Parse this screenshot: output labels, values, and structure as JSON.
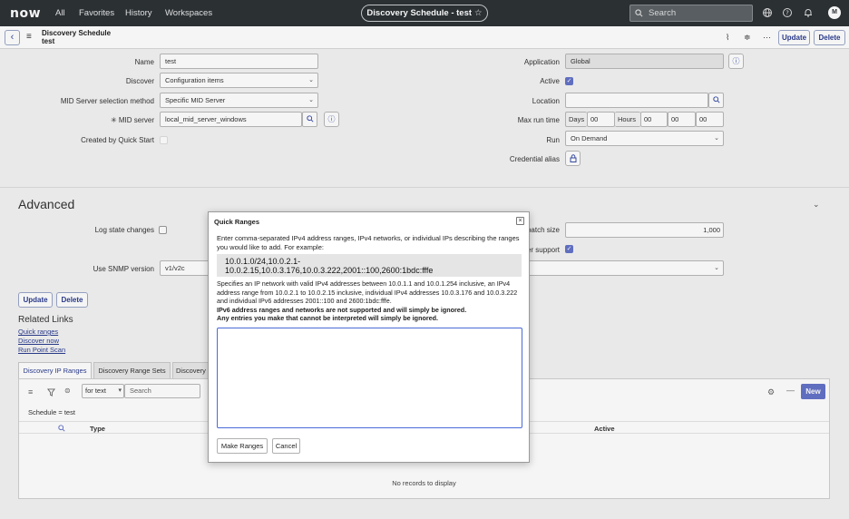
{
  "topnav": {
    "logo": "now",
    "menu": [
      "All",
      "Favorites",
      "History",
      "Workspaces"
    ],
    "context_title": "Discovery Schedule - test",
    "search_placeholder": "Search",
    "avatar_initial": "M"
  },
  "header": {
    "title_line1": "Discovery Schedule",
    "title_line2": "test",
    "update_label": "Update",
    "delete_label": "Delete"
  },
  "form": {
    "name": {
      "label": "Name",
      "value": "test"
    },
    "discover": {
      "label": "Discover",
      "value": "Configuration items"
    },
    "mid_method": {
      "label": "MID Server selection method",
      "value": "Specific MID Server"
    },
    "mid_server": {
      "label": "MID server",
      "required_mark": "✳",
      "value": "local_mid_server_windows"
    },
    "created_by_qs": {
      "label": "Created by Quick Start",
      "checked": false
    },
    "application": {
      "label": "Application",
      "value": "Global"
    },
    "active": {
      "label": "Active",
      "checked": true
    },
    "location": {
      "label": "Location",
      "value": ""
    },
    "max_run_time": {
      "label": "Max run time",
      "days_label": "Days",
      "days": "00",
      "hours_label": "Hours",
      "hours": "00",
      "minutes": "00",
      "seconds": "00"
    },
    "run": {
      "label": "Run",
      "value": "On Demand"
    },
    "credential_alias": {
      "label": "Credential alias"
    }
  },
  "advanced": {
    "title": "Advanced",
    "log_state_changes": {
      "label": "Log state changes",
      "checked": false
    },
    "use_snmp_version": {
      "label": "Use SNMP version",
      "value": "v1/v2c"
    },
    "batch_size": {
      "label": "batch size",
      "value": "1,000"
    },
    "er_support": {
      "label": "er support",
      "checked": true
    },
    "update_label": "Update",
    "delete_label": "Delete",
    "related_links_title": "Related Links",
    "related_links": [
      "Quick ranges",
      "Discover now",
      "Run Point Scan"
    ]
  },
  "tabs": [
    "Discovery IP Ranges",
    "Discovery Range Sets",
    "Discovery"
  ],
  "list": {
    "filter_select": "for text",
    "search_placeholder": "Search",
    "breadcrumb": "Schedule = test",
    "col_type": "Type",
    "col_active": "Active",
    "empty_text": "No records to display",
    "new_label": "New"
  },
  "modal": {
    "title": "Quick Ranges",
    "close": "×",
    "intro": "Enter comma-separated IPv4 address ranges, IPv4 networks, or individual IPs describing the ranges you would like to add. For example:",
    "example_line1": "10.0.1.0/24,10.0.2.1-",
    "example_line2": "10.0.2.15,10.0.3.176,10.0.3.222,2001::100,2600:1bdc:fffe",
    "desc": "Specifies an IP network with valid IPv4 addresses between 10.0.1.1 and 10.0.1.254 inclusive, an IPv4 address range from 10.0.2.1 to 10.0.2.15 inclusive, individual IPv4 addresses 10.0.3.176 and 10.0.3.222 and individual IPv6 addresses 2001::100 and 2600:1bdc:fffe.",
    "note1": "IPv6 address ranges and networks are not supported and will simply be ignored.",
    "note2": "Any entries you make that cannot be interpreted will simply be ignored.",
    "textarea_value": "",
    "make_ranges_label": "Make Ranges",
    "cancel_label": "Cancel"
  },
  "colors": {
    "nav_bg": "#2d3236",
    "accent": "#6473c8",
    "link": "#2b3c8f"
  }
}
